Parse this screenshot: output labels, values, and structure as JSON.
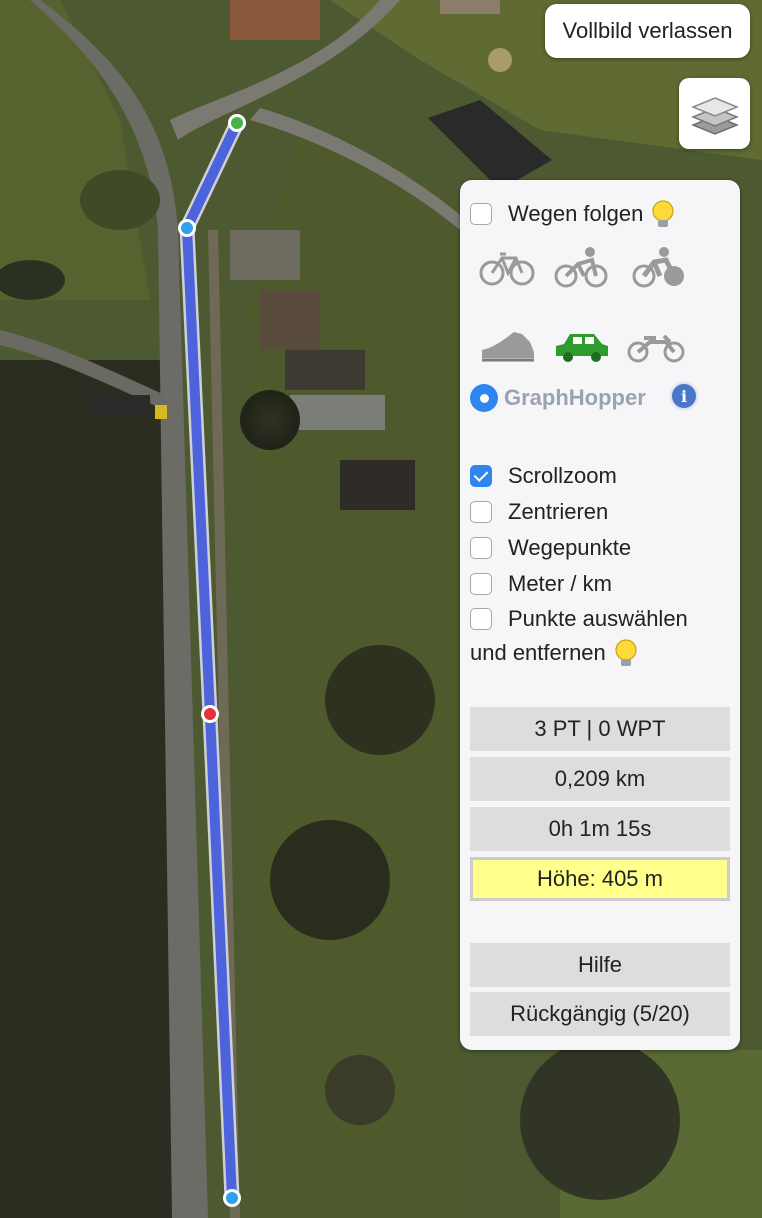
{
  "map": {
    "colors": {
      "route": "#4c63dc",
      "route_edge": "#c9c9d2",
      "start_marker": "#48b24b",
      "mid_marker": "#e3343c",
      "via_marker": "#2ea0ec"
    }
  },
  "fullscreen": {
    "exit_label": "Vollbild verlassen"
  },
  "layers": {
    "icon": "layers-icon"
  },
  "panel": {
    "follow_roads": {
      "label": "Wegen folgen",
      "checked": false,
      "hint_icon": "lightbulb-icon"
    },
    "modes": [
      {
        "name": "bicycle-icon",
        "active": false
      },
      {
        "name": "road-bike-icon",
        "active": false
      },
      {
        "name": "mountain-bike-icon",
        "active": false
      },
      {
        "name": "foot-icon",
        "active": false
      },
      {
        "name": "car-icon",
        "active": true
      },
      {
        "name": "motorcycle-icon",
        "active": false
      }
    ],
    "engine": {
      "label": "GraphHopper",
      "selected": true
    },
    "options": [
      {
        "label": "Scrollzoom",
        "checked": true
      },
      {
        "label": "Zentrieren",
        "checked": false
      },
      {
        "label": "Wegepunkte",
        "checked": false
      },
      {
        "label": "Meter / km",
        "checked": false
      },
      {
        "label": "Punkte auswählen",
        "checked": false
      }
    ],
    "options_wrap": "und entfernen",
    "stats": {
      "points": "3 PT | 0 WPT",
      "distance": "0,209 km",
      "duration": "0h 1m 15s",
      "elevation": "Höhe: 405 m"
    },
    "help_label": "Hilfe",
    "undo_label": "Rückgängig (5/20)"
  }
}
